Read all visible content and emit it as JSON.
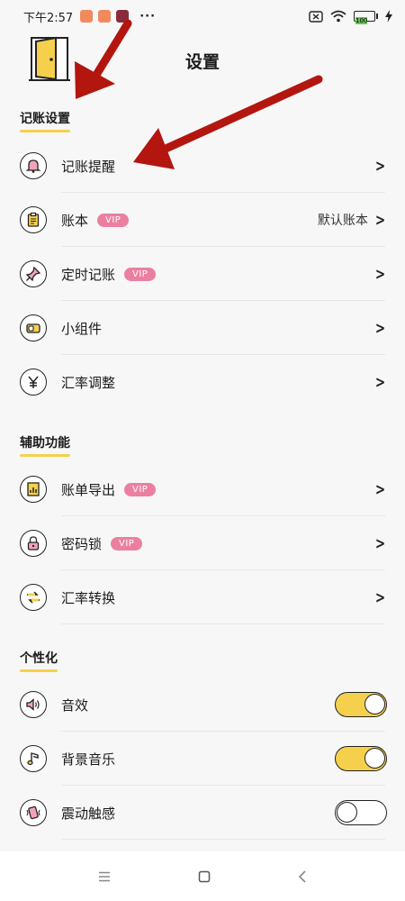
{
  "status": {
    "time": "下午2:57",
    "dots": "···",
    "battery": "100"
  },
  "header": {
    "title": "设置"
  },
  "sections": {
    "bookkeeping": {
      "title": "记账设置"
    },
    "assist": {
      "title": "辅助功能"
    },
    "personal": {
      "title": "个性化"
    }
  },
  "rows": {
    "reminder": {
      "label": "记账提醒",
      "icon": "bell-icon"
    },
    "ledger": {
      "label": "账本",
      "vip": "VIP",
      "value": "默认账本",
      "icon": "clipboard-icon"
    },
    "scheduled": {
      "label": "定时记账",
      "vip": "VIP",
      "icon": "pin-icon"
    },
    "widget": {
      "label": "小组件",
      "icon": "widget-icon"
    },
    "rate_adjust": {
      "label": "汇率调整",
      "icon": "yen-icon"
    },
    "export": {
      "label": "账单导出",
      "vip": "VIP",
      "icon": "chart-doc-icon"
    },
    "passcode": {
      "label": "密码锁",
      "vip": "VIP",
      "icon": "lock-icon"
    },
    "rate_convert": {
      "label": "汇率转换",
      "icon": "exchange-icon"
    },
    "sound": {
      "label": "音效",
      "icon": "speaker-icon",
      "on": true
    },
    "music": {
      "label": "背景音乐",
      "icon": "music-note-icon",
      "on": true
    },
    "vibrate": {
      "label": "震动触感",
      "icon": "vibrate-icon",
      "on": false
    }
  },
  "colors": {
    "accent": "#f5d04d",
    "vip": "#ec7fa0",
    "annotation_arrow": "#b3160f"
  }
}
